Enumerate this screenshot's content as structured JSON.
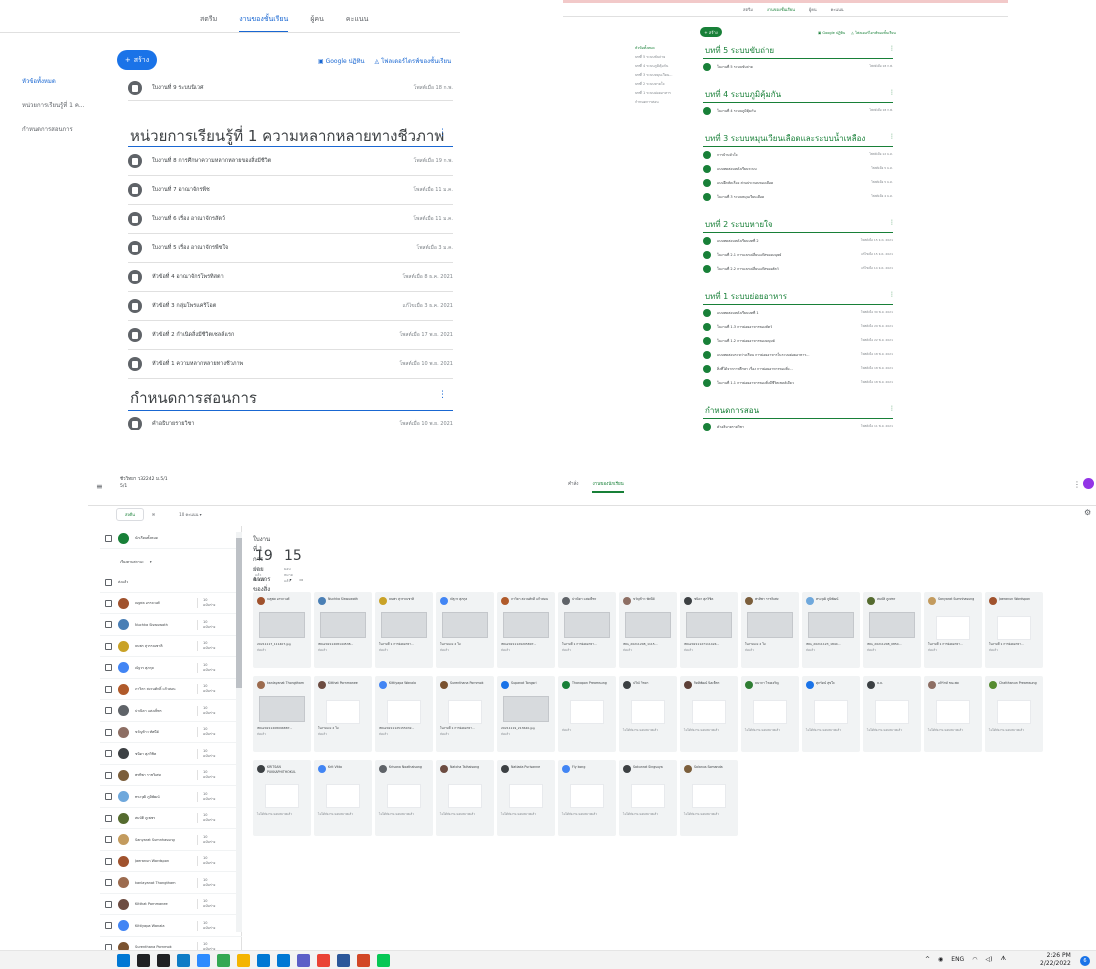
{
  "panel_a": {
    "tabs": [
      "สตรีม",
      "งานของชั้นเรียน",
      "ผู้คน",
      "คะแนน"
    ],
    "active_tab": 1,
    "create_label": "สร้าง",
    "google_calendar": "Google ปฏิทิน",
    "drive_folder": "โฟลเดอร์ไดรฟ์ของชั้นเรียน",
    "sidebar": [
      "หัวข้อทั้งหมด",
      "หน่วยการเรียนรู้ที่ 1 ค...",
      "กำหนดการสอนการ"
    ],
    "top_item": {
      "title": "ใบงานที่ 9 ระบบนิเวศ",
      "date": "โพสต์เมื่อ 18 ก.พ."
    },
    "section1_title": "หน่วยการเรียนรู้ที่ 1 ความหลากหลายทางชีวภาพ",
    "section1_items": [
      {
        "title": "ใบงานที่ 8 การศึกษาความหลากหลายของสิ่งมีชีวิต",
        "date": "โพสต์เมื่อ 19 ก.พ."
      },
      {
        "title": "ใบงานที่ 7 อาณาจักรพืช",
        "date": "โพสต์เมื่อ 11 ม.ค."
      },
      {
        "title": "ใบงานที่ 6 เรื่อง อาณาจักรสัตว์",
        "date": "โพสต์เมื่อ 11 ม.ค."
      },
      {
        "title": "ใบงานที่ 5 เรื่อง อาณาจักรพืชใจ",
        "date": "โพสต์เมื่อ 3 ม.ค."
      },
      {
        "title": "หัวข้อที่ 4 อาณาจักรโพรทิสตา",
        "date": "โพสต์เมื่อ 8 ธ.ค. 2021"
      },
      {
        "title": "หัวข้อที่ 3 กลุ่มโพรแคริโอต",
        "date": "แก้ไขเมื่อ 3 ธ.ค. 2021"
      },
      {
        "title": "หัวข้อที่ 2 กำเนิดสิ่งมีชีวิตเซลล์แรก",
        "date": "โพสต์เมื่อ 17 พ.ย. 2021"
      },
      {
        "title": "หัวข้อที่ 1 ความหลากหลายทางชีวภาพ",
        "date": "โพสต์เมื่อ 10 พ.ย. 2021"
      }
    ],
    "section2_title": "กำหนดการสอนการ",
    "section2_items": [
      {
        "title": "คำอธิบายรายวิชา",
        "date": "โพสต์เมื่อ 10 พ.ย. 2021"
      }
    ]
  },
  "panel_b": {
    "tabs": [
      "สตรีม",
      "งานของชั้นเรียน",
      "ผู้คน",
      "คะแนน"
    ],
    "create_label": "+ สร้าง",
    "google_calendar": "Google ปฏิทิน",
    "drive_folder": "โฟลเดอร์ไดรฟ์ของชั้นเรียน",
    "sidebar": [
      "หัวข้อทั้งหมด",
      "บทที่ 5 ระบบขับถ่าย",
      "บทที่ 4 ระบบภูมิคุ้มกัน",
      "บทที่ 3 ระบบหมุนเวียน...",
      "บทที่ 2 ระบบหายใจ",
      "บทที่ 1 ระบบย่อยอาหาร",
      "กำหนดการสอน"
    ],
    "sections": [
      {
        "title": "บทที่ 5 ระบบขับถ่าย",
        "items": [
          {
            "title": "ใบงานที่ 5 ระบบขับถ่าย",
            "date": "โพสต์เมื่อ 18 ก.พ."
          }
        ]
      },
      {
        "title": "บทที่ 4 ระบบภูมิคุ้มกัน",
        "items": [
          {
            "title": "ใบงานที่ 4 ระบบภูมิคุ้มกัน",
            "date": "โพสต์เมื่อ 18 ก.พ."
          }
        ]
      },
      {
        "title": "บทที่ 3 ระบบหมุนเวียนเลือดและระบบน้ำเหลือง",
        "items": [
          {
            "title": "การบ้านหัวใจ",
            "date": "โพสต์เมื่อ 12 ม.ค."
          },
          {
            "title": "แบบทดสอบหลังเรียนระบบ",
            "date": "โพสต์เมื่อ 5 ม.ค."
          },
          {
            "title": "แบบฝึกหัดเรื่อง ส่วนประกอบของเลือด",
            "date": "โพสต์เมื่อ 5 ม.ค."
          },
          {
            "title": "ใบงานที่ 3 ระบบหมุนเวียนเลือด",
            "date": "โพสต์เมื่อ 4 ม.ค."
          }
        ]
      },
      {
        "title": "บทที่ 2 ระบบหายใจ",
        "items": [
          {
            "title": "แบบทดสอบหลังเรียนบทที่ 2",
            "date": "โพสต์เมื่อ 15 ธ.ค. 2021"
          },
          {
            "title": "ใบงานที่ 2.1 การแลกเปลี่ยนแก๊สของมนุษย์",
            "date": "แก้ไขเมื่อ 15 ธ.ค. 2021"
          },
          {
            "title": "ใบงานที่ 2.2 การแลกเปลี่ยนแก๊สของสัตว์",
            "date": "แก้ไขเมื่อ 14 ธ.ค. 2021"
          }
        ]
      },
      {
        "title": "บทที่ 1 ระบบย่อยอาหาร",
        "items": [
          {
            "title": "แบบทดสอบหลังเรียนบทที่ 1",
            "date": "โพสต์เมื่อ 30 พ.ย. 2021"
          },
          {
            "title": "ใบงานที่ 1.3 การย่อยอาหารของสัตว์",
            "date": "โพสต์เมื่อ 29 พ.ย. 2021"
          },
          {
            "title": "ใบงานที่ 1.2 การย่อยอาหารของมนุษย์",
            "date": "โพสต์เมื่อ 22 พ.ย. 2021"
          },
          {
            "title": "แบบทดสอบระหว่างเรียน การย่อยอาหารในระบบย่อยอาหาร...",
            "date": "โพสต์เมื่อ 18 พ.ย. 2021"
          },
          {
            "title": "สิ่งที่ได้จากการศึกษา เรื่อง การย่อยอาหารของสิ่ง...",
            "date": "โพสต์เมื่อ 18 พ.ย. 2021"
          },
          {
            "title": "ใบงานที่ 1.1 การย่อยอาหารของสิ่งมีชีวิตเซลล์เดียว",
            "date": "โพสต์เมื่อ 18 พ.ย. 2021"
          }
        ]
      },
      {
        "title": "กำหนดการสอน",
        "items": [
          {
            "title": "คำอธิบายรายวิชา",
            "date": "โพสต์เมื่อ 11 พ.ย. 2021"
          }
        ]
      }
    ]
  },
  "panel_c": {
    "class_title": "ชีววิทยา ว32242 ม.5/1",
    "class_sub": "5/1",
    "tabs": [
      "คำสั่ง",
      "งานของนักเรียน"
    ],
    "return_btn": "ส่งคืน",
    "points": "10 คะแนน",
    "all_students": "นักเรียนทั้งหมด",
    "sort_label": "เรียงตามสถานะ",
    "section_label": "ส่งแล้ว",
    "students": [
      {
        "name": "ณฐพล อรรถวงศ์",
        "score": "10",
        "sub": "ฉบับร่าง",
        "color": "#a0522d"
      },
      {
        "name": "Nuchka Siswuwoth",
        "score": "10",
        "sub": "ฉบับร่าง",
        "color": "#4a7fb5"
      },
      {
        "name": "ธนพร สุวรรณชาติ",
        "score": "10",
        "sub": "ฉบับร่าง",
        "color": "#c9a227"
      },
      {
        "name": "ณัฐวร ศุภกุล",
        "score": "10",
        "sub": "ฉบับร่าง",
        "color": "#4285f4"
      },
      {
        "name": "ภาวิตา สงวนศักดิ์ แก้วสอน",
        "score": "10",
        "sub": "ฉบับร่าง",
        "color": "#b05a2a"
      },
      {
        "name": "ปาณิตา แสงเพ็ชร",
        "score": "10",
        "sub": "ฉบับร่าง",
        "color": "#5f6368"
      },
      {
        "name": "ขวัญข้าว ทัศนีย์",
        "score": "10",
        "sub": "ฉบับร่าง",
        "color": "#8d6e63"
      },
      {
        "name": "ชนิดา ศุภวิชิต",
        "score": "10",
        "sub": "ฉบับร่าง",
        "color": "#3c4043"
      },
      {
        "name": "พรทิพา ราชวิเศษ",
        "score": "10",
        "sub": "ฉบับร่าง",
        "color": "#7b5e3b"
      },
      {
        "name": "ทรงวุฒิ ภูมิพัฒน์",
        "score": "10",
        "sub": "ฉบับร่าง",
        "color": "#6fa8dc"
      },
      {
        "name": "สมบัติ ภูเพชร",
        "score": "10",
        "sub": "ฉบับร่าง",
        "color": "#556b2f"
      },
      {
        "name": "Sanyarat Sumnhasung",
        "score": "10",
        "sub": "ฉบับร่าง",
        "color": "#c39b5e"
      },
      {
        "name": "Jaeranun Wordspon",
        "score": "10",
        "sub": "ฉบับร่าง",
        "color": "#a0522d"
      },
      {
        "name": "kanlayanat Thongtham",
        "score": "10",
        "sub": "ฉบับร่าง",
        "color": "#9c6b4e"
      },
      {
        "name": "Kitthat Pornmanee",
        "score": "10",
        "sub": "ฉบับร่าง",
        "color": "#6d4c41"
      },
      {
        "name": "Kittiyapa Wanala",
        "score": "10",
        "sub": "ฉบับร่าง",
        "color": "#4285f4"
      },
      {
        "name": "Surenthana Pornmok",
        "score": "10",
        "sub": "ฉบับร่าง",
        "color": "#7a5230"
      }
    ],
    "assignment_title": "ใบงานที่ 1 การย่อยอาหารของสิ่งมีชีวิตเซลล์เดียว",
    "turned_in_count": "19",
    "turned_in_label": "ส่งแล้ว",
    "assigned_count": "15",
    "assigned_label": "มอบหมายแล้ว",
    "filter_label": "ทั้งหมด",
    "cards_row1": [
      {
        "name": "ณฐพล อรรถวงศ์",
        "file": "20211117_111407.jpg",
        "status": "ส่งแล้ว",
        "thumb": true,
        "color": "#a0522d"
      },
      {
        "name": "Nuchka Siswuwoth",
        "file": "IMG20211208144538...",
        "status": "ส่งแล้ว",
        "thumb": true,
        "color": "#4a7fb5"
      },
      {
        "name": "ธนพร สุวรรณชาติ",
        "file": "ใบงานที่ 1 การย่อยอาหา...",
        "status": "ส่งแล้ว",
        "thumb": true,
        "color": "#c9a227"
      },
      {
        "name": "ณัฐวร ศุภกุล",
        "file": "ใบงานบ.ม 2 ใบ",
        "status": "ส่งแล้ว",
        "thumb": true,
        "color": "#4285f4"
      },
      {
        "name": "ภาวิตา สงวนศักดิ์ แก้วสอน",
        "file": "IMG20211129205897...",
        "status": "ส่งแล้ว",
        "thumb": true,
        "color": "#b05a2a"
      },
      {
        "name": "ปาณิตา แสงเพ็ชร",
        "file": "ใบงานที่ 1 การย่อยอาหา...",
        "status": "ส่งแล้ว",
        "thumb": true,
        "color": "#5f6368"
      },
      {
        "name": "ขวัญข้าว ทัศนีย์",
        "file": "IMG_20211208_1115...",
        "status": "ส่งแล้ว",
        "thumb": true,
        "color": "#8d6e63"
      },
      {
        "name": "ชนิดา ศุภวิชิต",
        "file": "IMG20211127111424...",
        "status": "ส่งแล้ว",
        "thumb": true,
        "color": "#3c4043"
      },
      {
        "name": "พรทิพา ราชวิเศษ",
        "file": "ใบงานบ.ม 2 ใบ",
        "status": "ส่งแล้ว",
        "thumb": true,
        "color": "#7b5e3b"
      },
      {
        "name": "ทรงวุฒิ ภูมิพัฒน์",
        "file": "IMG_20211123_1844...",
        "status": "ส่งแล้ว",
        "thumb": true,
        "color": "#6fa8dc"
      },
      {
        "name": "สมบัติ ภูเพชร",
        "file": "IMG_20211208_0854...",
        "status": "ส่งแล้ว",
        "thumb": true,
        "color": "#556b2f"
      },
      {
        "name": "Sanyarat Sumnhasung",
        "file": "ใบงานที่ 1 การย่อยอาหา...",
        "status": "ส่งแล้ว",
        "thumb": false,
        "color": "#c39b5e"
      },
      {
        "name": "Jaeranun Wordspon",
        "file": "ใบงานที่ 1 การย่อยอาหา...",
        "status": "ส่งแล้ว",
        "thumb": false,
        "color": "#a0522d"
      }
    ],
    "cards_row2": [
      {
        "name": "kanlayanat Thongtham",
        "file": "IMG20211208096887...",
        "status": "ส่งแล้ว",
        "thumb": true,
        "color": "#9c6b4e"
      },
      {
        "name": "Kitthat Pornmanee",
        "file": "ใบงานบ.ม 2 ใบ",
        "status": "ส่งแล้ว",
        "thumb": false,
        "color": "#6d4c41"
      },
      {
        "name": "Kittiyapa Wanala",
        "file": "IMG20211125155032...",
        "status": "ส่งแล้ว",
        "thumb": false,
        "color": "#4285f4"
      },
      {
        "name": "Surenthana Pornmok",
        "file": "ใบงานที่ 1 การย่อยอาหา...",
        "status": "ส่งแล้ว",
        "thumb": false,
        "color": "#7a5230"
      },
      {
        "name": "Supanat Tongsri",
        "file": "20211119_213640.jpg",
        "status": "ส่งแล้ว",
        "thumb": true,
        "color": "#1a73e8"
      },
      {
        "name": "Thanapon Preamsung",
        "file": "",
        "status": "ส่งแล้ว",
        "thumb": false,
        "color": "#188038"
      },
      {
        "name": "ปวีณ์ วิชยา",
        "file": "",
        "status": "ไม่ได้ส่งงาน มอบหมายแล้ว",
        "thumb": false,
        "color": "#3c4043"
      },
      {
        "name": "กิตติพัฒน์ นิลเพ็ชร",
        "file": "",
        "status": "ไม่ได้ส่งงาน มอบหมายแล้ว",
        "thumb": false,
        "color": "#5d4037"
      },
      {
        "name": "ธนาภา ไชยเจริญ",
        "file": "",
        "status": "ไม่ได้ส่งงาน มอบหมายแล้ว",
        "thumb": false,
        "color": "#2e7d32"
      },
      {
        "name": "ศุภรัตน์ สุขใจ",
        "file": "",
        "status": "ไม่ได้ส่งงาน มอบหมายแล้ว",
        "thumb": false,
        "color": "#1a73e8"
      },
      {
        "name": "ธ.ธ.",
        "file": "",
        "status": "ไม่ได้ส่งงาน มอบหมายแล้ว",
        "thumb": false,
        "color": "#3c4043"
      },
      {
        "name": "อภิรักษ์ ชนะพล",
        "file": "",
        "status": "ไม่ได้ส่งงาน มอบหมายแล้ว",
        "thumb": false,
        "color": "#8d6e63"
      },
      {
        "name": "Chatthanun Preamsung",
        "file": "",
        "status": "ไม่ได้ส่งงาน มอบหมายแล้ว",
        "thumb": false,
        "color": "#558b2f"
      }
    ],
    "cards_row3": [
      {
        "name": "KRITSAN PUKKAPHITHOKUL",
        "file": "",
        "status": "ไม่ได้ส่งงาน มอบหมายแล้ว",
        "thumb": false,
        "color": "#3c4043"
      },
      {
        "name": "Krit Vitta",
        "file": "",
        "status": "ไม่ได้ส่งงาน มอบหมายแล้ว",
        "thumb": false,
        "color": "#4285f4"
      },
      {
        "name": "Krisana Noathaisong",
        "file": "",
        "status": "ไม่ได้ส่งงาน มอบหมายแล้ว",
        "thumb": false,
        "color": "#5f6368"
      },
      {
        "name": "Natcha Taihaisong",
        "file": "",
        "status": "ไม่ได้ส่งงาน มอบหมายแล้ว",
        "thumb": false,
        "color": "#6d4c41"
      },
      {
        "name": "Natlada Purisanne",
        "file": "",
        "status": "ไม่ได้ส่งงาน มอบหมายแล้ว",
        "thumb": false,
        "color": "#3c4043"
      },
      {
        "name": "Fly kong",
        "file": "",
        "status": "ไม่ได้ส่งงาน มอบหมายแล้ว",
        "thumb": false,
        "color": "#4285f4"
      },
      {
        "name": "Sakunrat Singsuya",
        "file": "",
        "status": "ไม่ได้ส่งงาน มอบหมายแล้ว",
        "thumb": false,
        "color": "#3c4043"
      },
      {
        "name": "Salanus Somanda",
        "file": "",
        "status": "ไม่ได้ส่งงาน มอบหมายแล้ว",
        "thumb": false,
        "color": "#7b5e3b"
      }
    ]
  },
  "taskbar": {
    "lang": "ENG",
    "time": "2:26 PM",
    "date": "2/22/2022",
    "notif_count": "6",
    "apps": [
      {
        "name": "windows-start-icon",
        "color": "#0078d4"
      },
      {
        "name": "search-icon",
        "color": "#202124"
      },
      {
        "name": "task-view-icon",
        "color": "#202124"
      },
      {
        "name": "edge-icon",
        "color": "#0f7cc6"
      },
      {
        "name": "zoom-icon",
        "color": "#2d8cff"
      },
      {
        "name": "chrome-icon",
        "color": "#34a853"
      },
      {
        "name": "file-explorer-icon",
        "color": "#f4b400"
      },
      {
        "name": "store-icon",
        "color": "#0078d4"
      },
      {
        "name": "mail-icon",
        "color": "#0078d4"
      },
      {
        "name": "teams-icon",
        "color": "#5b5fc7"
      },
      {
        "name": "chrome-profile-icon",
        "color": "#ea4335"
      },
      {
        "name": "word-icon",
        "color": "#2b579a"
      },
      {
        "name": "powerpoint-icon",
        "color": "#d24726"
      },
      {
        "name": "line-icon",
        "color": "#06c755"
      }
    ]
  }
}
